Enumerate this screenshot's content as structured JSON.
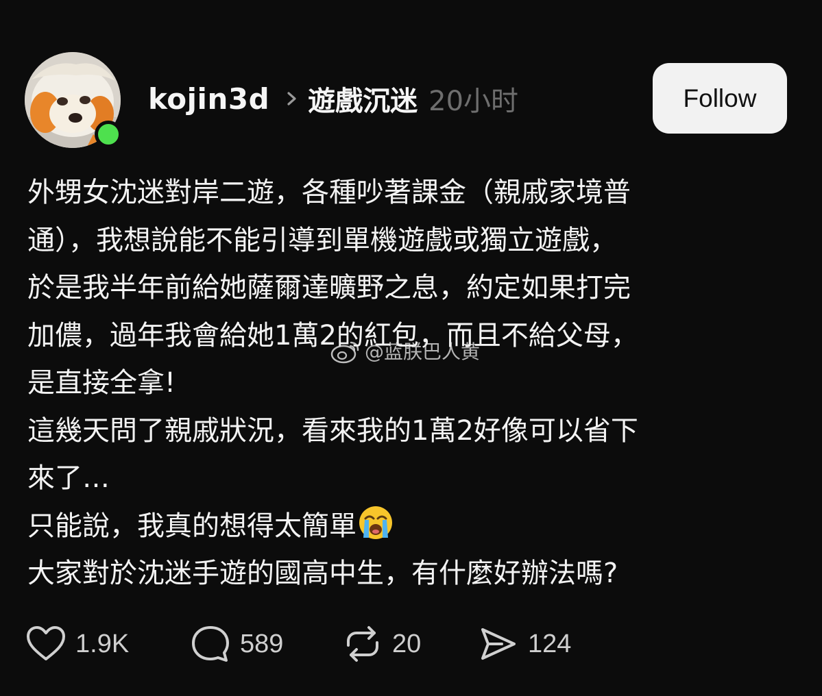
{
  "header": {
    "username": "kojin3d",
    "topic": "遊戲沉迷",
    "time": "20小时",
    "follow_label": "Follow",
    "online_color": "#4ee04e"
  },
  "post": {
    "lines": [
      "外甥女沈迷對岸二遊，各種吵著課金（親戚家境普",
      "通），我想說能不能引導到單機遊戲或獨立遊戲，",
      "於是我半年前給她薩爾達曠野之息，約定如果打完",
      "加儂，過年我會給她1萬2的紅包，而且不給父母，",
      "是直接全拿!",
      "這幾天問了親戚狀況，看來我的1萬2好像可以省下",
      "來了…",
      "只能說，我真的想得太簡單",
      "大家對於沈迷手遊的國高中生，有什麼好辦法嗎?"
    ],
    "emoji": "loudly-crying-face"
  },
  "watermark": {
    "text": "@蓝朕巴人黄",
    "icon": "weibo-icon"
  },
  "actions": {
    "likes": "1.9K",
    "comments": "589",
    "reposts": "20",
    "shares": "124"
  }
}
